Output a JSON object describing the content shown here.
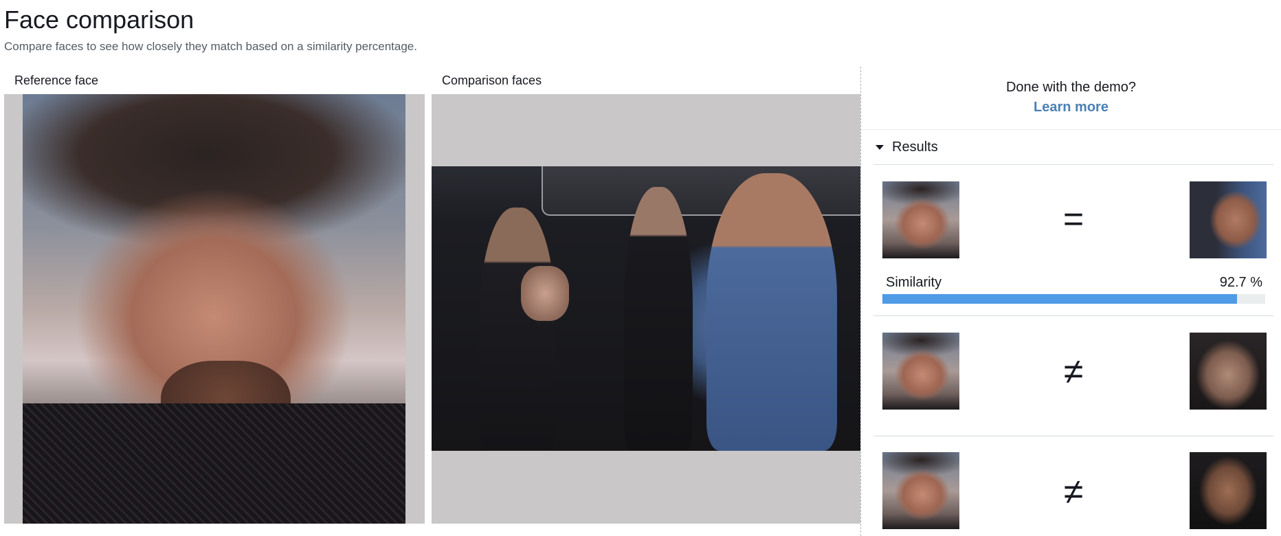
{
  "header": {
    "title": "Face comparison",
    "subtitle": "Compare faces to see how closely they match based on a similarity percentage."
  },
  "panels": {
    "reference_label": "Reference face",
    "comparison_label": "Comparison faces"
  },
  "sidebar": {
    "done_text": "Done with the demo?",
    "learn_more": "Learn more",
    "results_label": "Results"
  },
  "results": [
    {
      "symbol": "=",
      "match": true,
      "similarity_label": "Similarity",
      "similarity_text": "92.7 %",
      "similarity": 92.7
    },
    {
      "symbol": "≠",
      "match": false
    },
    {
      "symbol": "≠",
      "match": false
    }
  ],
  "colors": {
    "accent": "#4f9be6",
    "link": "#4a7fb5",
    "frame_bg": "#c9c7c8"
  }
}
